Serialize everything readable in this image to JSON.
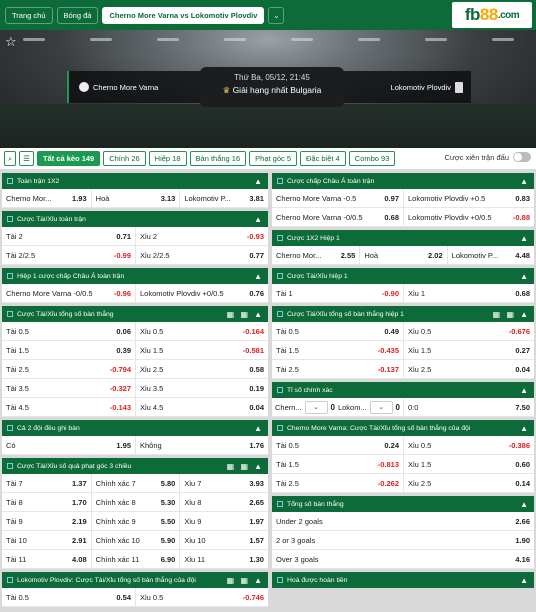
{
  "nav": {
    "home": "Trang chủ",
    "football": "Bóng đá",
    "match": "Cherno More Varna vs Lokomotiv Plovdiv",
    "chev": "⌄"
  },
  "logo": {
    "a": "fb",
    "b": "88",
    "c": ".com"
  },
  "match": {
    "home": "Cherno More Varna",
    "away": "Lokomotiv Plovdiv",
    "datetime": "Thứ Ba, 05/12, 21:45",
    "league": "Giải hạng nhất Bulgaria"
  },
  "tabs": {
    "all": "Tất cả kèo 149",
    "main": "Chính 26",
    "half": "Hiệp 18",
    "goals": "Bàn thắng 16",
    "corners": "Phạt góc 5",
    "special": "Đặc biệt 4",
    "combo": "Combo 93",
    "live_label": "Cược xiên trận đấu"
  },
  "left": [
    {
      "title": "Toàn trận 1X2",
      "grid": false,
      "rows": [
        [
          [
            "Cherno Mor...",
            "1.93"
          ],
          [
            "Hoà",
            "3.13"
          ],
          [
            "Lokomotiv P...",
            "3.81"
          ]
        ]
      ]
    },
    {
      "title": "Cược Tài/Xỉu toàn trận",
      "grid": false,
      "rows": [
        [
          [
            "Tài 2",
            "0.71"
          ],
          [
            "Xỉu 2",
            "-0.93"
          ]
        ],
        [
          [
            "Tài 2/2.5",
            "-0.99"
          ],
          [
            "Xỉu 2/2.5",
            "0.77"
          ]
        ]
      ]
    },
    {
      "title": "Hiệp 1 cược chấp Châu Á toàn trận",
      "grid": false,
      "rows": [
        [
          [
            "Cherno More Varna -0/0.5",
            "-0.96"
          ],
          [
            "Lokomotiv Plovdiv +0/0.5",
            "0.76"
          ]
        ]
      ]
    },
    {
      "title": "Cược Tài/Xỉu tổng số bàn thắng",
      "grid": true,
      "rows": [
        [
          [
            "Tài 0.5",
            "0.06"
          ],
          [
            "Xỉu 0.5",
            "-0.164"
          ]
        ],
        [
          [
            "Tài 1.5",
            "0.39"
          ],
          [
            "Xỉu 1.5",
            "-0.581"
          ]
        ],
        [
          [
            "Tài 2.5",
            "-0.794"
          ],
          [
            "Xỉu 2.5",
            "0.58"
          ]
        ],
        [
          [
            "Tài 3.5",
            "-0.327"
          ],
          [
            "Xỉu 3.5",
            "0.19"
          ]
        ],
        [
          [
            "Tài 4.5",
            "-0.143"
          ],
          [
            "Xỉu 4.5",
            "0.04"
          ]
        ]
      ]
    },
    {
      "title": "Cả 2 đội đều ghi bàn",
      "grid": false,
      "rows": [
        [
          [
            "Có",
            "1.95"
          ],
          [
            "Không",
            "1.76"
          ]
        ]
      ]
    },
    {
      "title": "Cược Tài/Xỉu số quả phạt góc 3 chiều",
      "grid": true,
      "rows": [
        [
          [
            "Tài 7",
            "1.37"
          ],
          [
            "Chính xác 7",
            "5.80"
          ],
          [
            "Xỉu 7",
            "3.93"
          ]
        ],
        [
          [
            "Tài 8",
            "1.70"
          ],
          [
            "Chính xác 8",
            "5.30"
          ],
          [
            "Xỉu 8",
            "2.65"
          ]
        ],
        [
          [
            "Tài 9",
            "2.19"
          ],
          [
            "Chính xác 9",
            "5.50"
          ],
          [
            "Xỉu 9",
            "1.97"
          ]
        ],
        [
          [
            "Tài 10",
            "2.91"
          ],
          [
            "Chính xác 10",
            "5.90"
          ],
          [
            "Xỉu 10",
            "1.57"
          ]
        ],
        [
          [
            "Tài 11",
            "4.08"
          ],
          [
            "Chính xác 11",
            "6.90"
          ],
          [
            "Xỉu 11",
            "1.30"
          ]
        ]
      ]
    },
    {
      "title": "Lokomotiv Plovdiv: Cược Tài/Xỉu tổng số bàn thắng của đội",
      "grid": true,
      "rows": [
        [
          [
            "Tài 0.5",
            "0.54"
          ],
          [
            "Xỉu 0.5",
            "-0.746"
          ]
        ]
      ]
    }
  ],
  "right": [
    {
      "title": "Cược chấp Châu Á toàn trận",
      "grid": false,
      "rows": [
        [
          [
            "Cherno More Varna -0.5",
            "0.97"
          ],
          [
            "Lokomotiv Plovdiv +0.5",
            "0.83"
          ]
        ],
        [
          [
            "Cherno More Varna -0/0.5",
            "0.68"
          ],
          [
            "Lokomotiv Plovdiv +0/0.5",
            "-0.88"
          ]
        ]
      ]
    },
    {
      "title": "Cược 1X2 Hiệp 1",
      "grid": false,
      "rows": [
        [
          [
            "Cherno Mor...",
            "2.55"
          ],
          [
            "Hoà",
            "2.02"
          ],
          [
            "Lokomotiv P...",
            "4.48"
          ]
        ]
      ]
    },
    {
      "title": "Cược Tài/Xỉu hiệp 1",
      "grid": false,
      "rows": [
        [
          [
            "Tài 1",
            "-0.90"
          ],
          [
            "Xỉu 1",
            "0.68"
          ]
        ]
      ]
    },
    {
      "title": "Cược Tài/Xỉu tổng số bàn thắng hiệp 1",
      "grid": true,
      "rows": [
        [
          [
            "Tài 0.5",
            "0.49"
          ],
          [
            "Xỉu 0.5",
            "-0.676"
          ]
        ],
        [
          [
            "Tài 1.5",
            "-0.435"
          ],
          [
            "Xỉu 1.5",
            "0.27"
          ]
        ],
        [
          [
            "Tài 2.5",
            "-0.137"
          ],
          [
            "Xỉu 2.5",
            "0.04"
          ]
        ]
      ]
    },
    {
      "title": "Tỉ số chính xác",
      "grid": false,
      "score": {
        "h": "Chern...",
        "hv": "0",
        "a": "Lokom...",
        "av": "0",
        "res": "0:0",
        "odd": "7.50"
      }
    },
    {
      "title": "Cherno More Varna: Cược Tài/Xỉu tổng số bàn thắng của đội",
      "grid": false,
      "rows": [
        [
          [
            "Tài 0.5",
            "0.24"
          ],
          [
            "Xỉu 0.5",
            "-0.386"
          ]
        ],
        [
          [
            "Tài 1.5",
            "-0.813"
          ],
          [
            "Xỉu 1.5",
            "0.60"
          ]
        ],
        [
          [
            "Tài 2.5",
            "-0.262"
          ],
          [
            "Xỉu 2.5",
            "0.14"
          ]
        ]
      ]
    },
    {
      "title": "Tổng số bàn thắng",
      "grid": false,
      "rows": [
        [
          [
            "Under 2 goals",
            "2.66"
          ]
        ],
        [
          [
            "2 or 3 goals",
            "1.90"
          ]
        ],
        [
          [
            "Over 3 goals",
            "4.16"
          ]
        ]
      ]
    },
    {
      "title": "Hoà được hoàn tiền",
      "grid": false,
      "rows": []
    }
  ]
}
